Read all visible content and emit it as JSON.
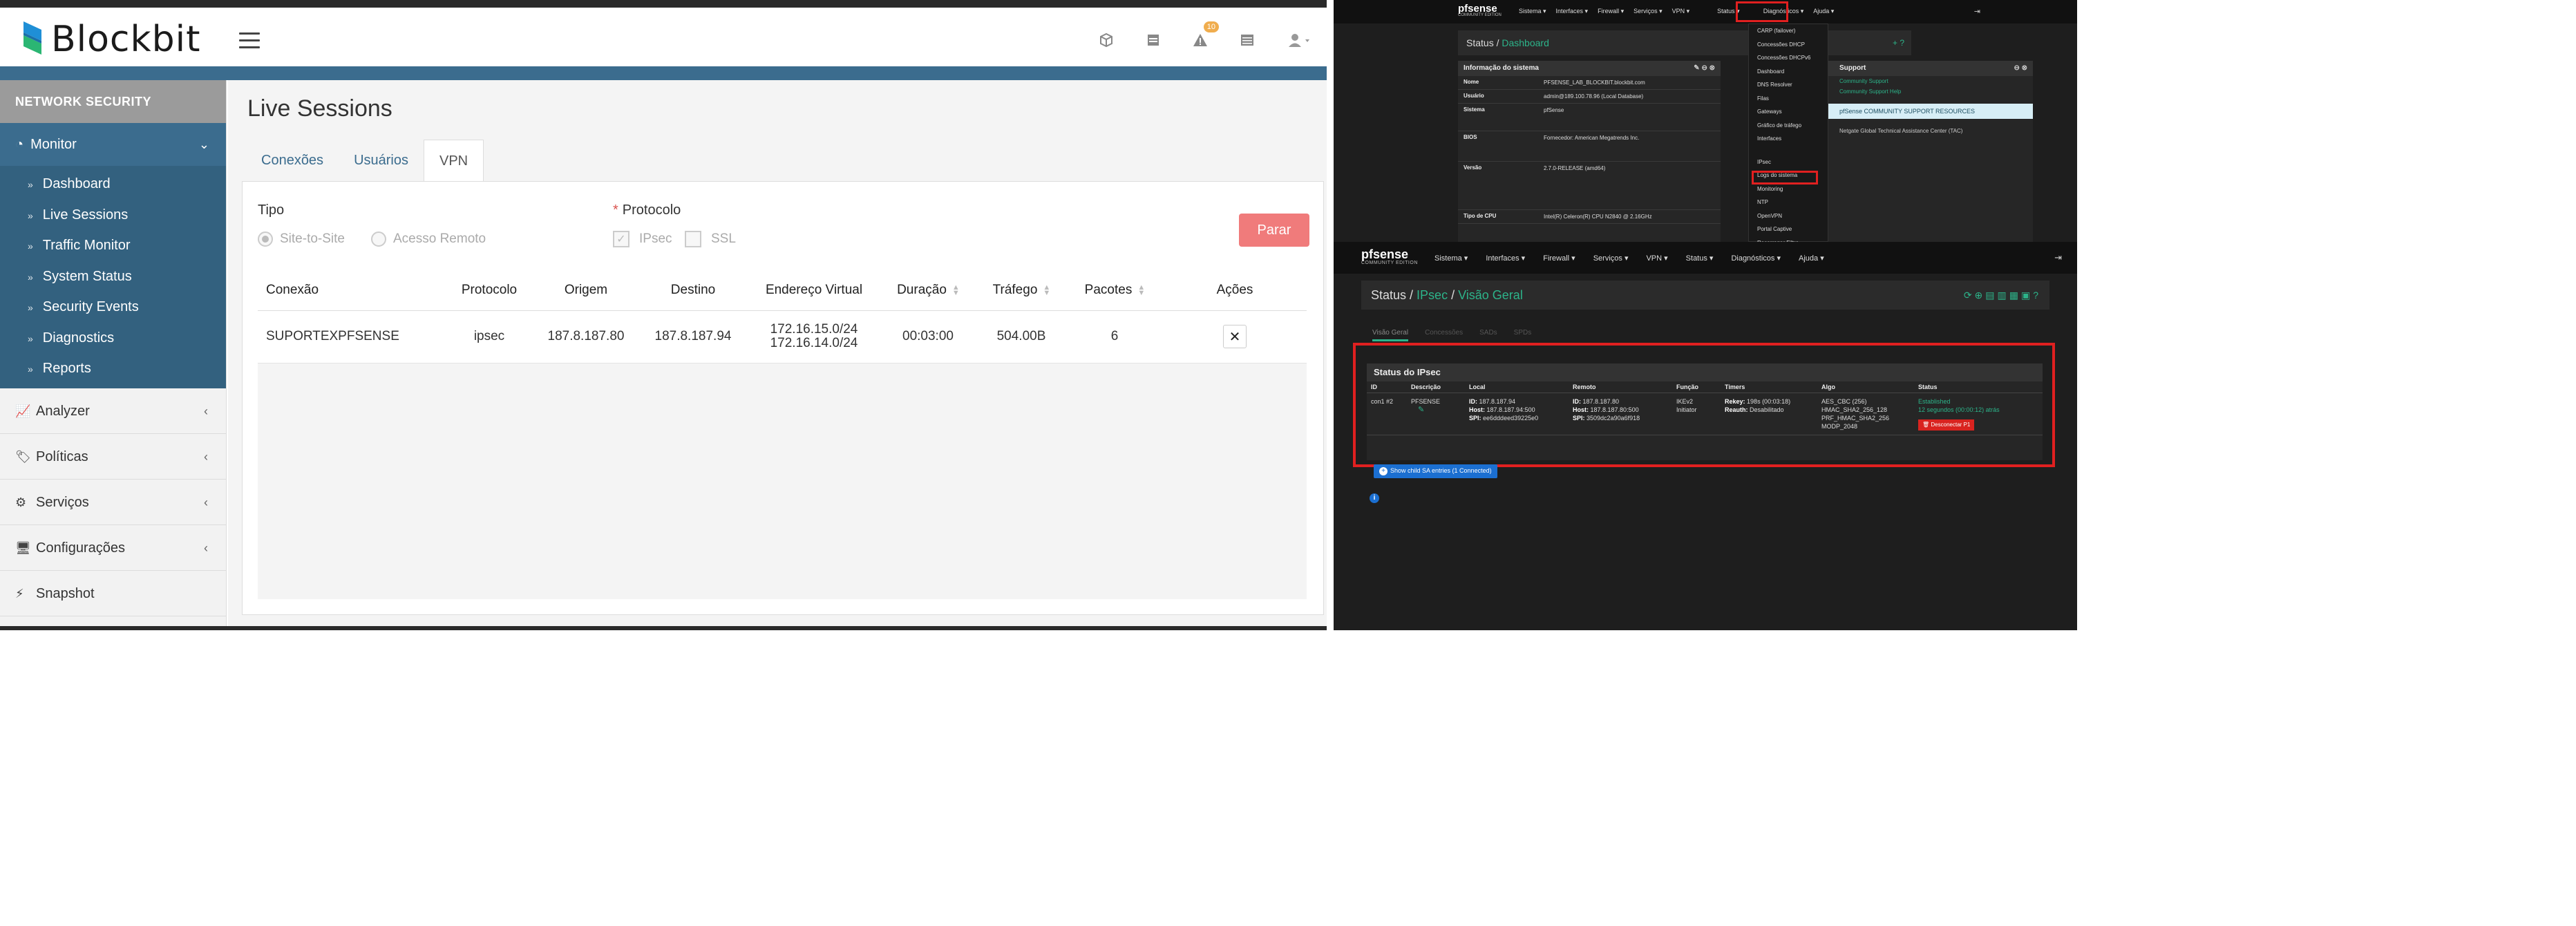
{
  "blockbit": {
    "brand": "Blockbit",
    "header": {
      "alert_badge": "10"
    },
    "sidebar": {
      "section_title": "NETWORK SECURITY",
      "monitor_label": "Monitor",
      "monitor_items": [
        "Dashboard",
        "Live Sessions",
        "Traffic Monitor",
        "System Status",
        "Security Events",
        "Diagnostics",
        "Reports"
      ],
      "items": [
        {
          "label": "Analyzer",
          "icon": "chart-line-icon"
        },
        {
          "label": "Políticas",
          "icon": "tag-icon"
        },
        {
          "label": "Serviços",
          "icon": "gears-icon"
        },
        {
          "label": "Configurações",
          "icon": "monitor-icon"
        },
        {
          "label": "Snapshot",
          "icon": "bolt-icon"
        }
      ]
    },
    "page_title": "Live Sessions",
    "tabs": [
      "Conexões",
      "Usuários",
      "VPN"
    ],
    "active_tab": "VPN",
    "form": {
      "tipo_label": "Tipo",
      "tipo_options": [
        "Site-to-Site",
        "Acesso Remoto"
      ],
      "protocolo_label": "Protocolo",
      "protocolo_required": "*",
      "protocolo_options": [
        "IPsec",
        "SSL"
      ],
      "stop_button": "Parar"
    },
    "table": {
      "columns": [
        "Conexão",
        "Protocolo",
        "Origem",
        "Destino",
        "Endereço Virtual",
        "Duração",
        "Tráfego",
        "Pacotes",
        "Ações"
      ],
      "rows": [
        {
          "conexao": "SUPORTEXPFSENSE",
          "protocolo": "ipsec",
          "origem": "187.8.187.80",
          "destino": "187.8.187.94",
          "endereco_virtual_1": "172.16.15.0/24",
          "endereco_virtual_2": "172.16.14.0/24",
          "duracao": "00:03:00",
          "trafego": "504.00B",
          "pacotes": "6"
        }
      ]
    },
    "colors": {
      "accent": "#3b6c8e",
      "stop_button": "#f07b7b"
    }
  },
  "pfsense_dashboard": {
    "logo": "pfsense",
    "logo_sub": "COMMUNITY EDITION",
    "nav": [
      "Sistema ▾",
      "Interfaces ▾",
      "Firewall ▾",
      "Serviços ▾",
      "VPN ▾",
      "Status ▾",
      "Diagnósticos ▾",
      "Ajuda ▾"
    ],
    "breadcrumb_1": "Status",
    "breadcrumb_2": "Dashboard",
    "info_widget_title": "Informação do sistema",
    "info_rows": [
      {
        "k": "Nome",
        "v": "PFSENSE_LAB_BLOCKBIT.blockbit.com"
      },
      {
        "k": "Usuário",
        "v": "admin@189.100.78.96 (Local Database)"
      },
      {
        "k": "Sistema",
        "v": "pfSense"
      },
      {
        "k": "BIOS",
        "v": "Fornecedor: American Megatrends Inc."
      },
      {
        "k": "Versão",
        "v": "2.7.0-RELEASE (amd64)"
      },
      {
        "k": "Tipo de CPU",
        "v": "Intel(R) Celeron(R) CPU N2840 @ 2.16GHz"
      }
    ],
    "status_menu": [
      "CARP (failover)",
      "Concessões DHCP",
      "Concessões DHCPv6",
      "Dashboard",
      "DNS Resolver",
      "Filas",
      "Gateways",
      "Gráfico de tráfego",
      "Interfaces",
      "IPsec",
      "Logs do sistema",
      "Monitoring",
      "NTP",
      "OpenVPN",
      "Portal Captive",
      "Recarregar Filtro"
    ],
    "support_title": "Support",
    "support_links": [
      "Community Support",
      "Community Support Help"
    ],
    "support_band": "pfSense COMMUNITY SUPPORT RESOURCES",
    "support_text": "Netgate Global Technical Assistance Center (TAC)"
  },
  "pfsense_ipsec": {
    "logo": "pfsense",
    "logo_sub": "COMMUNITY EDITION",
    "nav": [
      "Sistema ▾",
      "Interfaces ▾",
      "Firewall ▾",
      "Serviços ▾",
      "VPN ▾",
      "Status ▾",
      "Diagnósticos ▾",
      "Ajuda ▾"
    ],
    "breadcrumb_1": "Status",
    "breadcrumb_2": "IPsec",
    "breadcrumb_3": "Visão Geral",
    "subtabs": [
      "Visão Geral",
      "Concessões",
      "SADs",
      "SPDs"
    ],
    "panel_title": "Status do IPsec",
    "columns": [
      "ID",
      "Descrição",
      "Local",
      "Remoto",
      "Função",
      "Timers",
      "Algo",
      "Status"
    ],
    "row": {
      "id": "con1 #2",
      "descricao": "PFSENSE",
      "local_id": "187.8.187.94",
      "local_host": "187.8.187.94:500",
      "local_spi": "ee6dddeed39225e0",
      "remote_id": "187.8.187.80",
      "remote_host": "187.8.187.80:500",
      "remote_spi": "3509dc2a90a6f918",
      "funcao_1": "IKEv2",
      "funcao_2": "Initiator",
      "rekey": "198s (00:03:18)",
      "result": "Desabilitado",
      "algo_1": "AES_CBC (256)",
      "algo_2": "HMAC_SHA2_256_128",
      "algo_3": "PRF_HMAC_SHA2_256",
      "algo_4": "MODP_2048",
      "status_1": "Established",
      "status_2": "12 segundos (00:00:12) atrás",
      "disconnect": "Desconectar P1"
    },
    "show_child": "Show child SA entries (1 Connected)"
  }
}
